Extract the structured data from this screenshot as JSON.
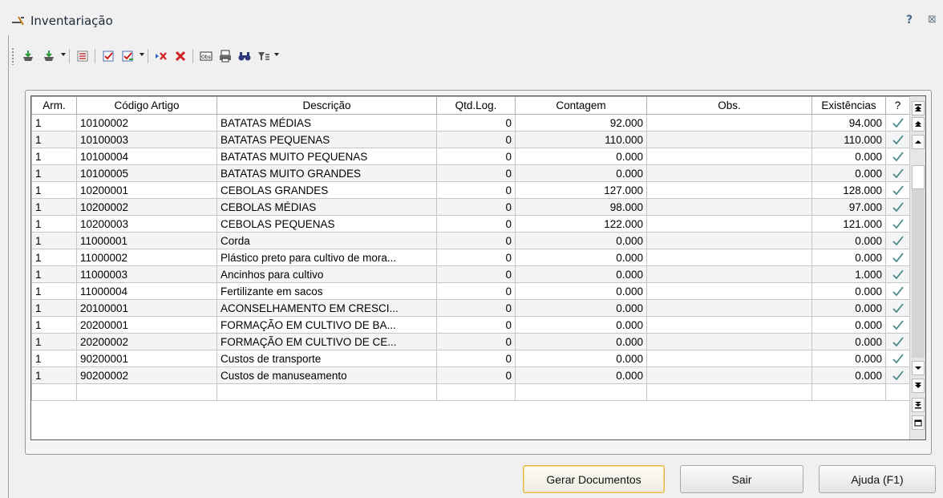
{
  "window": {
    "title": "Inventariação",
    "help_label": "?",
    "close_label": "⊠"
  },
  "toolbar": {
    "icons": [
      "load-icon",
      "load-dropdown-icon",
      "list-icon",
      "check-icon",
      "check-dropdown-icon",
      "delete-row-icon",
      "delete-all-icon",
      "observations-icon",
      "print-icon",
      "find-icon",
      "filter-icon"
    ]
  },
  "grid": {
    "headers": [
      "Arm.",
      "Código Artigo",
      "Descrição",
      "Qtd.Log.",
      "Contagem",
      "Obs.",
      "Existências",
      "?"
    ],
    "rows": [
      [
        "1",
        "10100002",
        "BATATAS MÉDIAS",
        "0",
        "92.000",
        "",
        "94.000"
      ],
      [
        "1",
        "10100003",
        "BATATAS PEQUENAS",
        "0",
        "110.000",
        "",
        "110.000"
      ],
      [
        "1",
        "10100004",
        "BATATAS MUITO PEQUENAS",
        "0",
        "0.000",
        "",
        "0.000"
      ],
      [
        "1",
        "10100005",
        "BATATAS MUITO GRANDES",
        "0",
        "0.000",
        "",
        "0.000"
      ],
      [
        "1",
        "10200001",
        "CEBOLAS GRANDES",
        "0",
        "127.000",
        "",
        "128.000"
      ],
      [
        "1",
        "10200002",
        "CEBOLAS MÉDIAS",
        "0",
        "98.000",
        "",
        "97.000"
      ],
      [
        "1",
        "10200003",
        "CEBOLAS PEQUENAS",
        "0",
        "122.000",
        "",
        "121.000"
      ],
      [
        "1",
        "11000001",
        "Corda",
        "0",
        "0.000",
        "",
        "0.000"
      ],
      [
        "1",
        "11000002",
        "Plástico preto para cultivo de mora...",
        "0",
        "0.000",
        "",
        "0.000"
      ],
      [
        "1",
        "11000003",
        "Ancinhos para cultivo",
        "0",
        "0.000",
        "",
        "1.000"
      ],
      [
        "1",
        "11000004",
        "Fertilizante em sacos",
        "0",
        "0.000",
        "",
        "0.000"
      ],
      [
        "1",
        "20100001",
        "ACONSELHAMENTO EM CRESCI...",
        "0",
        "0.000",
        "",
        "0.000"
      ],
      [
        "1",
        "20200001",
        "FORMAÇÃO EM CULTIVO DE BA...",
        "0",
        "0.000",
        "",
        "0.000"
      ],
      [
        "1",
        "20200002",
        "FORMAÇÃO EM CULTIVO DE CE...",
        "0",
        "0.000",
        "",
        "0.000"
      ],
      [
        "1",
        "90200001",
        "Custos de transporte",
        "0",
        "0.000",
        "",
        "0.000"
      ],
      [
        "1",
        "90200002",
        "Custos de manuseamento",
        "0",
        "0.000",
        "",
        "0.000"
      ]
    ],
    "check_color": "#4a8a8a"
  },
  "buttons": {
    "generate": "Gerar Documentos",
    "exit": "Sair",
    "help": "Ajuda (F1)"
  }
}
